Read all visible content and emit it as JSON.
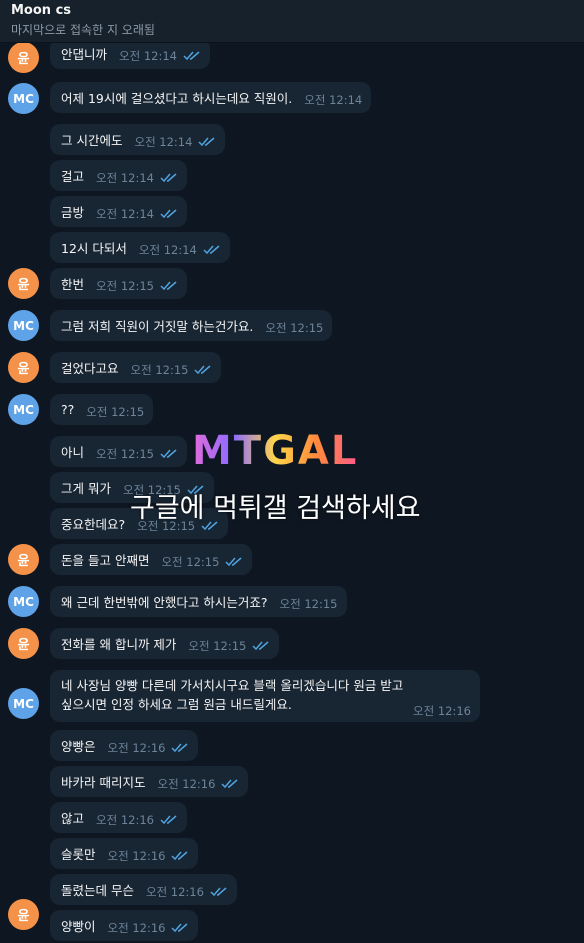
{
  "header": {
    "contact_name": "Moon cs",
    "status": "마지막으로 접속한 지 오래됨"
  },
  "avatars": {
    "mc": "MC",
    "yu": "윤"
  },
  "messages": [
    {
      "text": "안댑니까",
      "time": "오전 12:14",
      "sender": "yu"
    },
    {
      "text": "어제 19시에 걸으셨다고 하시는데요 직원이.",
      "time": "오전 12:14",
      "sender": "mc"
    },
    {
      "text": "그 시간에도",
      "time": "오전 12:14",
      "sender": "yu"
    },
    {
      "text": "걸고",
      "time": "오전 12:14",
      "sender": "yu"
    },
    {
      "text": "금방",
      "time": "오전 12:14",
      "sender": "yu"
    },
    {
      "text": "12시 다되서",
      "time": "오전 12:14",
      "sender": "yu"
    },
    {
      "text": "한번",
      "time": "오전 12:15",
      "sender": "yu"
    },
    {
      "text": "그럼 저희 직원이 거짓말 하는건가요.",
      "time": "오전 12:15",
      "sender": "mc"
    },
    {
      "text": "걸었다고요",
      "time": "오전 12:15",
      "sender": "yu"
    },
    {
      "text": "??",
      "time": "오전 12:15",
      "sender": "mc"
    },
    {
      "text": "아니",
      "time": "오전 12:15",
      "sender": "yu"
    },
    {
      "text": "그게 뭐가",
      "time": "오전 12:15",
      "sender": "yu"
    },
    {
      "text": "중요한데요?",
      "time": "오전 12:15",
      "sender": "yu"
    },
    {
      "text": "돈을 들고 안째면",
      "time": "오전 12:15",
      "sender": "yu"
    },
    {
      "text": "왜 근데 한번밖에 안했다고 하시는거죠?",
      "time": "오전 12:15",
      "sender": "mc"
    },
    {
      "text": "전화를 왜 합니까 제가",
      "time": "오전 12:15",
      "sender": "yu"
    },
    {
      "text_line1": "네 사장님 양빵 다른데 가서치시구요 블랙 올리겠습니다 원금 받고",
      "text_line2": "싶으시면 인정 하세요 그럼 원금 내드릴게요.",
      "time": "오전 12:16",
      "sender": "mc"
    },
    {
      "text": "양빵은",
      "time": "오전 12:16",
      "sender": "yu"
    },
    {
      "text": "바카라 때리지도",
      "time": "오전 12:16",
      "sender": "yu"
    },
    {
      "text": "않고",
      "time": "오전 12:16",
      "sender": "yu"
    },
    {
      "text": "슬롯만",
      "time": "오전 12:16",
      "sender": "yu"
    },
    {
      "text": "돌렸는데 무슨",
      "time": "오전 12:16",
      "sender": "yu"
    },
    {
      "text": "양빵이",
      "time": "오전 12:16",
      "sender": "yu"
    }
  ],
  "watermark": {
    "logo": "MTGAL",
    "caption": "구글에 먹튀갤 검색하세요"
  },
  "colors": {
    "background": "#0e1621",
    "bubble": "#182533",
    "time": "#6d8499",
    "ticks": "#4fa3e0",
    "mc_avatar": "#5ea2e8",
    "yu_avatar": "#f4924a"
  }
}
